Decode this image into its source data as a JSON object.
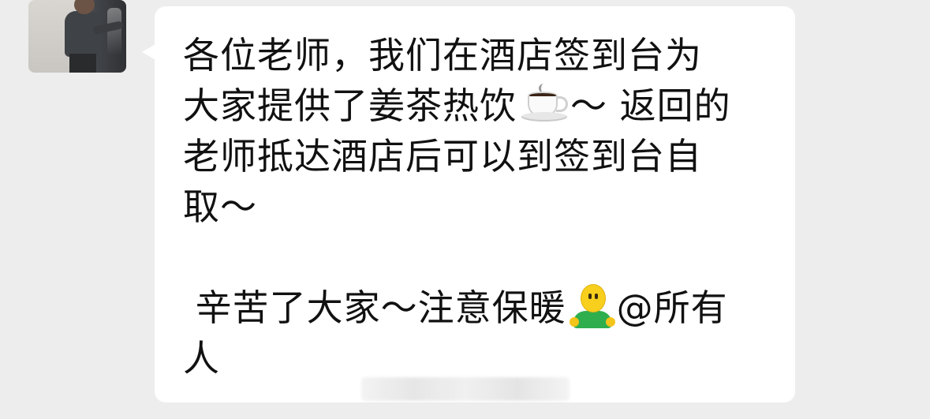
{
  "message": {
    "lines": [
      "各位老师，我们在酒店签到台为",
      "大家提供了姜茶热饮",
      "～ 返回的",
      "老师抵达酒店后可以到签到台自",
      "取～",
      " 辛苦了大家～注意保暖",
      "@所有",
      "人"
    ],
    "emoji": {
      "coffee": "hot-beverage",
      "smiley": "person-shrugging"
    }
  },
  "colors": {
    "background": "#ededed",
    "bubble": "#ffffff",
    "text": "#111111"
  }
}
